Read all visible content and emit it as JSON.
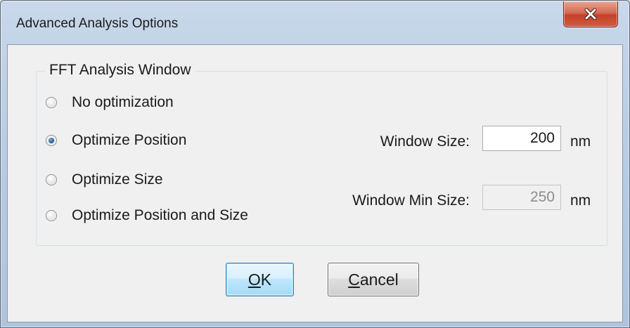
{
  "window": {
    "title": "Advanced Analysis Options",
    "close_icon": "close-x-icon"
  },
  "group": {
    "label": "FFT Analysis Window",
    "options": [
      {
        "label": "No optimization",
        "checked": false
      },
      {
        "label": "Optimize Position",
        "checked": true
      },
      {
        "label": "Optimize Size",
        "checked": false
      },
      {
        "label": "Optimize Position and Size",
        "checked": false
      }
    ]
  },
  "fields": {
    "window_size": {
      "label": "Window Size:",
      "value": "200",
      "unit": "nm",
      "enabled": true
    },
    "window_min_size": {
      "label": "Window Min Size:",
      "value": "250",
      "unit": "nm",
      "enabled": false
    }
  },
  "buttons": {
    "ok": {
      "mnemonic": "O",
      "rest": "K"
    },
    "cancel": {
      "mnemonic": "C",
      "rest": "ancel"
    }
  }
}
